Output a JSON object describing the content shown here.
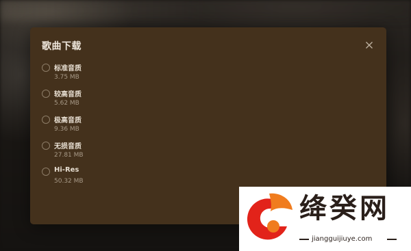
{
  "dialog": {
    "title": "歌曲下载",
    "close_icon": "close-icon",
    "options": [
      {
        "label": "标准音质",
        "size": "3.75 MB"
      },
      {
        "label": "较高音质",
        "size": "5.62 MB"
      },
      {
        "label": "极高音质",
        "size": "9.36 MB"
      },
      {
        "label": "无损音质",
        "size": "27.81 MB"
      },
      {
        "label": "Hi-Res",
        "size": "50.32 MB"
      }
    ]
  },
  "watermark": {
    "title": "绛癸网",
    "url": "jiangguijiuye.com"
  },
  "colors": {
    "dialog_bg": "#44311c",
    "title_text": "#efe7dc",
    "watermark_orange": "#f07c1e",
    "watermark_red": "#e2231a"
  }
}
